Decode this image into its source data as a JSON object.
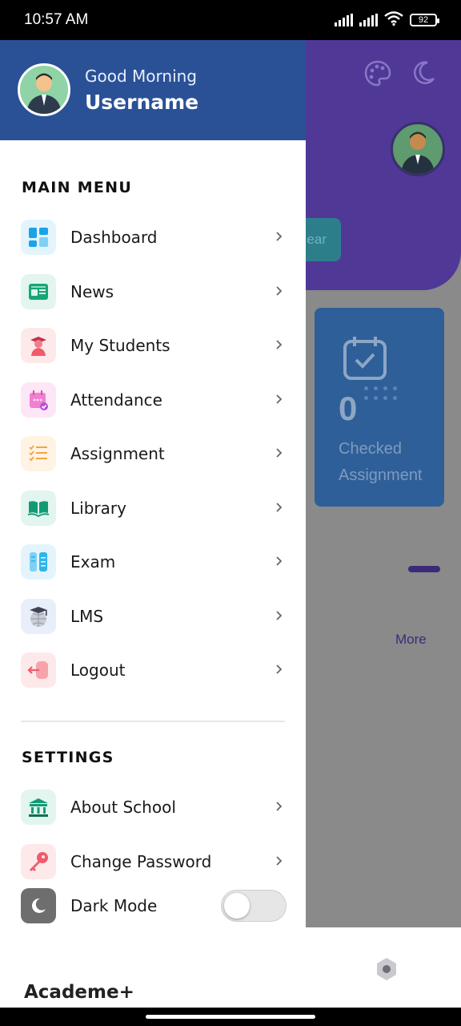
{
  "status_bar": {
    "time": "10:57 AM",
    "battery": "92",
    "icons": [
      "signal-icon",
      "signal-icon",
      "wifi-icon",
      "battery-icon"
    ]
  },
  "background": {
    "chip_text": "ear",
    "card": {
      "count": "0",
      "label_line1": "Checked",
      "label_line2": "Assignment"
    },
    "more_link": "More"
  },
  "drawer": {
    "greeting": "Good Morning",
    "username": "Username",
    "main_menu_title": "MAIN MENU",
    "main_menu": [
      {
        "label": "Dashboard",
        "icon": "dashboard-icon",
        "bg": "#e3f4fc",
        "color": "#1aa3e8"
      },
      {
        "label": "News",
        "icon": "news-icon",
        "bg": "#e2f5ee",
        "color": "#17a577"
      },
      {
        "label": "My Students",
        "icon": "student-icon",
        "bg": "#fde9ea",
        "color": "#ef5b6b"
      },
      {
        "label": "Attendance",
        "icon": "attendance-icon",
        "bg": "#fde6f5",
        "color": "#e565c4"
      },
      {
        "label": "Assignment",
        "icon": "assignment-icon",
        "bg": "#fff3e4",
        "color": "#f5a443"
      },
      {
        "label": "Library",
        "icon": "library-icon",
        "bg": "#e2f5ef",
        "color": "#139a75"
      },
      {
        "label": "Exam",
        "icon": "exam-icon",
        "bg": "#e3f4fc",
        "color": "#2fb4ec"
      },
      {
        "label": "LMS",
        "icon": "lms-icon",
        "bg": "#e9effa",
        "color": "#5b6474"
      },
      {
        "label": "Logout",
        "icon": "logout-icon",
        "bg": "#fde9ea",
        "color": "#f0727f"
      }
    ],
    "settings_title": "SETTINGS",
    "settings": [
      {
        "label": "About School",
        "icon": "school-icon",
        "bg": "#e2f5ee",
        "color": "#139a75"
      },
      {
        "label": "Change Password",
        "icon": "key-icon",
        "bg": "#fde9ea",
        "color": "#ef5b6b"
      }
    ],
    "dark_mode": {
      "label": "Dark Mode",
      "icon": "moon-icon",
      "enabled": false,
      "icon_bg": "#6e6e6e"
    }
  },
  "app_name": "Academe+",
  "colors": {
    "drawer_header": "#2a5196",
    "app_header": "#4f3896",
    "overlay": "#8a8a8a"
  }
}
